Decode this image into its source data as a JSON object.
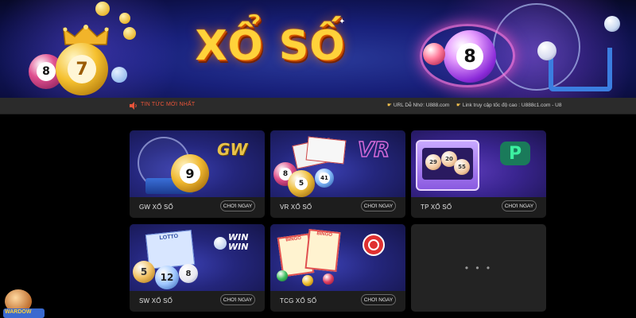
{
  "banner": {
    "title": "XỔ SỐ",
    "balls": [
      "8",
      "7",
      "8"
    ]
  },
  "newsbar": {
    "news_label": "TIN TỨC MỚI NHẤT",
    "url_note": "URL Dễ Nhớ: U888.com",
    "fast_link": "Link truy cập tốc độ cao : U888c1.com - U8"
  },
  "cards": [
    {
      "caption": "GW XỔ SỐ",
      "button": "CHƠI NGAY",
      "brand": "GW",
      "ball": "9"
    },
    {
      "caption": "VR XỔ SỐ",
      "button": "CHƠI NGAY",
      "brand": "VR",
      "balls": [
        "8",
        "5",
        "41"
      ]
    },
    {
      "caption": "TP XỔ SỐ",
      "button": "CHƠI NGAY",
      "brand": "P",
      "balls": [
        "29",
        "20",
        "55"
      ]
    },
    {
      "caption": "SW XỔ SỐ",
      "button": "CHƠI NGAY",
      "brand_top": "WIN",
      "brand_bottom": "WIN",
      "ticket": "LOTTO",
      "balls": [
        "5",
        "12",
        "8"
      ]
    },
    {
      "caption": "TCG XỔ SỐ",
      "button": "CHƠI NGAY",
      "tickets": [
        "BINGO",
        "BINGO"
      ]
    }
  ],
  "placeholder": {
    "dots": "• • •"
  },
  "mascot": {
    "label": "WARDOW"
  },
  "colors": {
    "accent": "#ffd23a",
    "news_red": "#e8543a",
    "background": "#000000",
    "card": "#1d1d1d"
  }
}
